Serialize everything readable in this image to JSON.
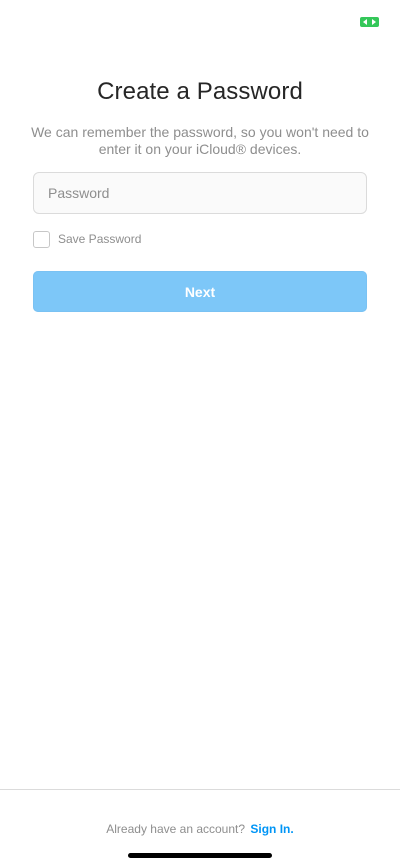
{
  "status_bar": {
    "indicator_icon": "screen-record-icon",
    "indicator_color": "#34c759"
  },
  "header": {
    "title": "Create a Password",
    "subtitle": "We can remember the password, so you won't need to enter it on your iCloud® devices."
  },
  "form": {
    "password_placeholder": "Password",
    "password_value": "",
    "save_password_label": "Save Password",
    "save_password_checked": false,
    "next_label": "Next",
    "next_color": "#7dc7f8"
  },
  "footer": {
    "prompt": "Already have an account?",
    "sign_in_label": "Sign In.",
    "link_color": "#0095f6"
  }
}
